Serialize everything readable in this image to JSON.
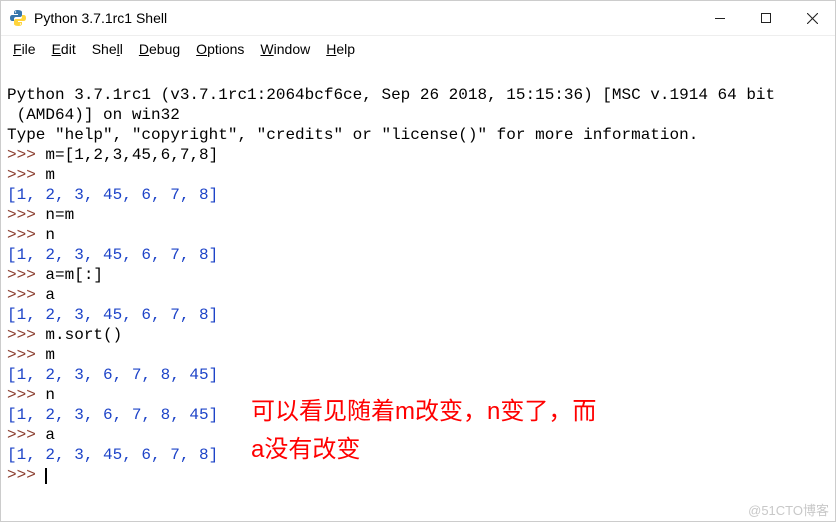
{
  "titlebar": {
    "title": "Python 3.7.1rc1 Shell"
  },
  "menu": {
    "file": {
      "u": "F",
      "rest": "ile"
    },
    "edit": {
      "u": "E",
      "rest": "dit"
    },
    "shell": {
      "pre": "She",
      "u": "l",
      "post": "l"
    },
    "debug": {
      "u": "D",
      "rest": "ebug"
    },
    "options": {
      "u": "O",
      "rest": "ptions"
    },
    "window": {
      "u": "W",
      "rest": "indow"
    },
    "help": {
      "u": "H",
      "rest": "elp"
    }
  },
  "console": {
    "banner1": "Python 3.7.1rc1 (v3.7.1rc1:2064bcf6ce, Sep 26 2018, 15:15:36) [MSC v.1914 64 bit",
    "banner2": " (AMD64)] on win32",
    "banner3": "Type \"help\", \"copyright\", \"credits\" or \"license()\" for more information.",
    "prompt": ">>>",
    "l1": " m=[1,2,3,45,6,7,8]",
    "l2": " m",
    "o1": "[1, 2, 3, 45, 6, 7, 8]",
    "l3": " n=m",
    "l4": " n",
    "o2": "[1, 2, 3, 45, 6, 7, 8]",
    "l5": " a=m[:]",
    "l6": " a",
    "o3": "[1, 2, 3, 45, 6, 7, 8]",
    "l7": " m.sort()",
    "l8": " m",
    "o4": "[1, 2, 3, 6, 7, 8, 45]",
    "l9": " n",
    "o5": "[1, 2, 3, 6, 7, 8, 45]",
    "l10": " a",
    "o6": "[1, 2, 3, 45, 6, 7, 8]",
    "empty": " "
  },
  "annotation": {
    "line1": "可以看见随着m改变，n变了，而",
    "line2": "a没有改变"
  },
  "watermark": "@51CTO博客"
}
